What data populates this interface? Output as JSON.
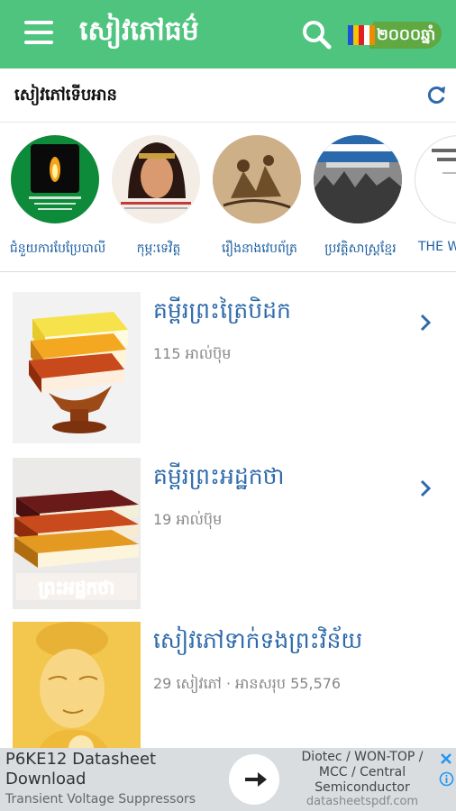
{
  "app_bar": {
    "title": "សៀវភៅធម៌",
    "menu_icon": "menu-icon",
    "search_icon": "search-icon",
    "year_badge": "២០០០ឆ្នាំ",
    "background": "#4ec47f"
  },
  "recent": {
    "title": "សៀវភៅទើបអាន",
    "refresh_icon": "refresh-icon",
    "items": [
      {
        "label": "ជំនួយការបែប្រែបាលី"
      },
      {
        "label": "កុម្ភៈទេវិត្ត"
      },
      {
        "label": "រឿងនាងវេបព័ត្រ"
      },
      {
        "label": "ប្រវត្តិសាស្ត្រខ្មែរ"
      },
      {
        "label": "THE W"
      }
    ]
  },
  "collections": [
    {
      "title": "គម្ពីរព្រះត្រៃបិដក",
      "subtitle": "115 អាល់ប៊ុម",
      "chevron": true
    },
    {
      "title": "គម្ពីរព្រះអដ្ឋកថា",
      "subtitle": "19 អាល់ប៊ុម",
      "chevron": true,
      "cover_text": "ព្រះអដ្ឋកថា"
    },
    {
      "title": "សៀវភៅទាក់ទងព្រះវិន័យ",
      "subtitle": "29 សៀវភៅ · អានសរុប  55,576",
      "chevron": false
    }
  ],
  "ad": {
    "title": "P6KE12 Datasheet Download",
    "subtitle": "Transient Voltage Suppressors",
    "description": "Diotec / WON-TOP / MCC / Central Semiconductor",
    "domain": "datasheetspdf.com",
    "accent": "#2196f3"
  }
}
